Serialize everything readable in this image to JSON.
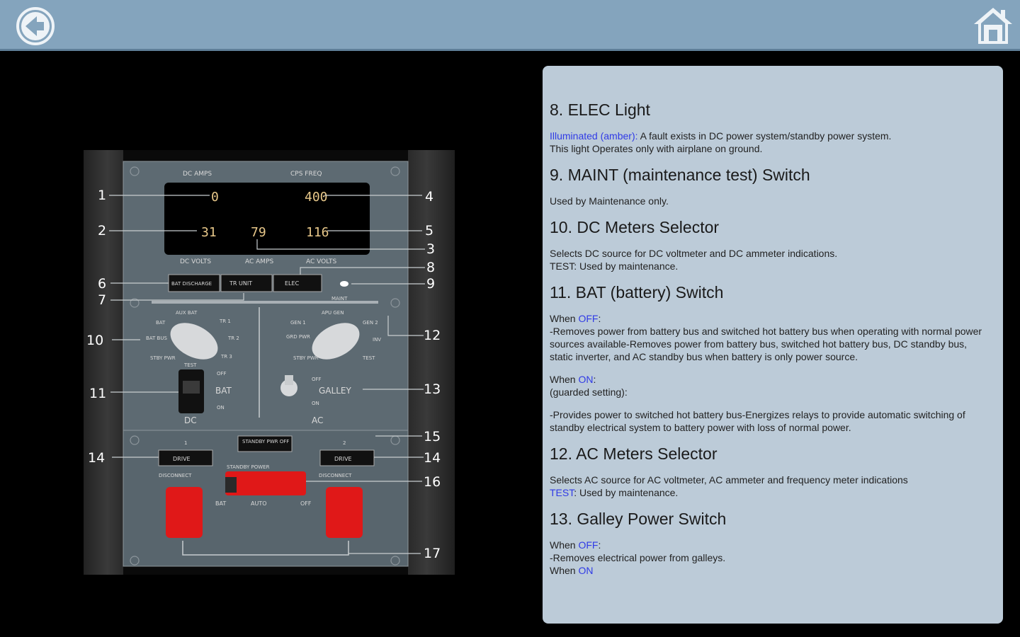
{
  "topbar": {
    "back_icon": "back-arrow-icon",
    "home_icon": "home-icon",
    "bar_color": "#84a4bd"
  },
  "panel": {
    "top_labels": {
      "dc_amps": "DC  AMPS",
      "cps_freq": "CPS  FREQ"
    },
    "display": {
      "dc_amps": "0",
      "cps_freq": "400",
      "dc_volts": "31",
      "ac_amps": "79",
      "ac_volts": "116"
    },
    "bottom_labels": {
      "dc_volts": "DC  VOLTS",
      "ac_amps": "AC  AMPS",
      "ac_volts": "AC  VOLTS"
    },
    "lights": [
      "BAT DISCHARGE",
      "TR UNIT",
      "ELEC"
    ],
    "maint_label": "MAINT",
    "dc_selector": {
      "label_auxbat": "AUX BAT",
      "label_bat": "BAT",
      "label_batbus": "BAT BUS",
      "label_stby": "STBY PWR",
      "label_test": "TEST",
      "label_tr1": "TR 1",
      "label_tr2": "TR 2",
      "label_tr3": "TR 3"
    },
    "ac_selector": {
      "label_apu": "APU GEN",
      "label_gen1": "GEN 1",
      "label_gen2": "GEN 2",
      "label_grd": "GRD PWR",
      "label_inv": "INV",
      "label_stby": "STBY PWR",
      "label_test": "TEST"
    },
    "bat_switch": {
      "off": "OFF",
      "label": "BAT",
      "on": "ON"
    },
    "galley_switch": {
      "off": "OFF",
      "label": "GALLEY",
      "on": "ON"
    },
    "section_labels": {
      "dc": "DC",
      "ac": "AC"
    },
    "lower": {
      "standby_pwr_off": "STANDBY PWR OFF",
      "drive1": "DRIVE",
      "drive2": "DRIVE",
      "num1": "1",
      "num2": "2",
      "disconnect1": "DISCONNECT",
      "disconnect2": "DISCONNECT",
      "standby_power": "STANDBY POWER",
      "bat": "BAT",
      "auto": "AUTO",
      "off": "OFF"
    },
    "callouts": [
      "1",
      "2",
      "3",
      "4",
      "5",
      "6",
      "7",
      "8",
      "9",
      "10",
      "11",
      "12",
      "13",
      "14",
      "14",
      "15",
      "16",
      "17"
    ]
  },
  "info": {
    "s8_title": "8. ELEC Light",
    "s8_key": "Illuminated (amber):",
    "s8_text1": " A fault exists in DC power system/standby power system.",
    "s8_text2": "This light Operates only with airplane on ground.",
    "s9_title": "9. MAINT (maintenance test) Switch",
    "s9_text": "Used by Maintenance only.",
    "s10_title": "10. DC Meters Selector",
    "s10_text1": "Selects DC source for DC voltmeter and DC ammeter indications.",
    "s10_text2": "TEST: Used by maintenance.",
    "s11_title": "11. BAT (battery) Switch",
    "s11_when_off_pre": "When ",
    "s11_off": "OFF",
    "s11_when_off_post": ":",
    "s11_off_text": "-Removes power from battery bus and switched hot battery bus when operating with normal power sources available-Removes power from battery bus, switched hot battery bus, DC standby bus, static inverter, and AC standby bus when battery is only power source.",
    "s11_when_on_pre": "When ",
    "s11_on": "ON",
    "s11_when_on_post": ":",
    "s11_guarded": "(guarded setting):",
    "s11_on_text": "-Provides power to switched hot battery bus-Energizes relays to provide automatic switching of standby electrical system to battery power with loss of normal power.",
    "s12_title": "12. AC Meters Selector",
    "s12_text1": "Selects AC source for AC voltmeter, AC ammeter and frequency meter indications",
    "s12_test": "TEST",
    "s12_text2": ": Used by maintenance.",
    "s13_title": "13. Galley Power Switch",
    "s13_when_off_pre": "When ",
    "s13_off": "OFF",
    "s13_when_off_post": ":",
    "s13_off_text": "-Removes electrical power from galleys.",
    "s13_when_on_pre": "When ",
    "s13_on": "ON"
  }
}
